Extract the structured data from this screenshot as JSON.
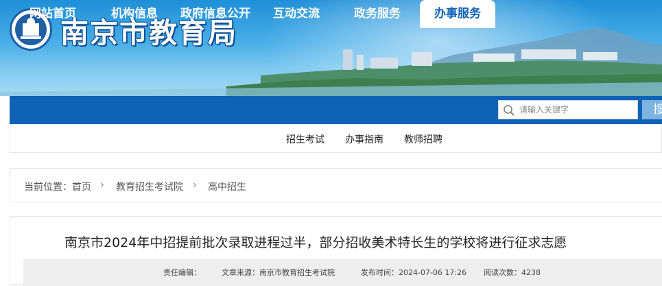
{
  "header": {
    "site_title": "南京市教育局"
  },
  "nav": {
    "items": [
      {
        "label": "网站首页"
      },
      {
        "label": "机构信息"
      },
      {
        "label": "政府信息公开"
      },
      {
        "label": "互动交流"
      },
      {
        "label": "政务服务"
      },
      {
        "label": "办事服务",
        "active": true
      }
    ],
    "search_placeholder": "请输入关键字",
    "search_button": "搜",
    "accent_color": "#0f63b7"
  },
  "subnav": {
    "items": [
      {
        "label": "招生考试"
      },
      {
        "label": "办事指南"
      },
      {
        "label": "教师招聘"
      }
    ]
  },
  "breadcrumb": {
    "prefix": "当前位置：",
    "items": [
      "首页",
      "教育招生考试院",
      "高中招生"
    ]
  },
  "article": {
    "title": "南京市2024年中招提前批次录取进程过半，部分招收美术特长生的学校将进行征求志愿",
    "editor": "责任编辑：",
    "source": "文章来源：南京市教育招生考试院",
    "publish_time": "发布时间：2024-07-06 17:26",
    "views": "阅读次数：4238"
  }
}
